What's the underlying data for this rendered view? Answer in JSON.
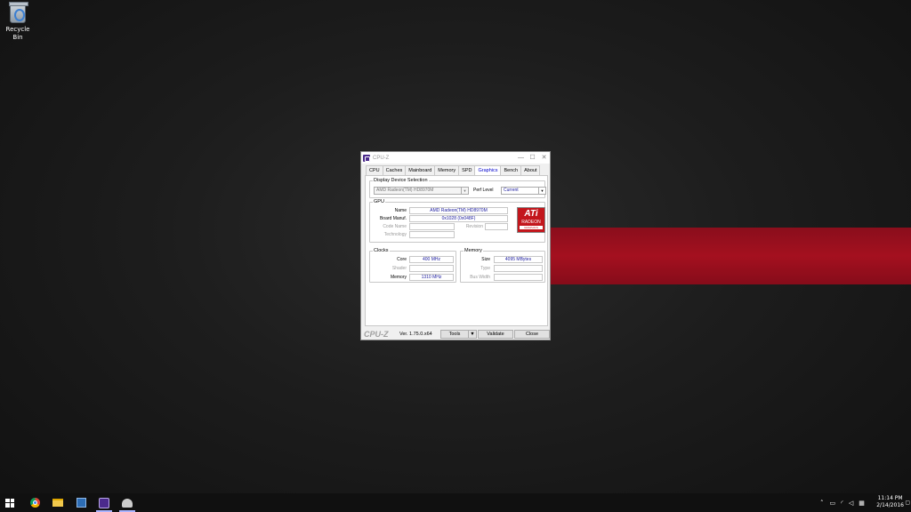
{
  "desktop": {
    "icons": [
      {
        "label": "Recycle Bin",
        "icon": "recycle-bin-icon"
      }
    ]
  },
  "window": {
    "title": "CPU-Z",
    "controls": {
      "minimize": "—",
      "maximize": "☐",
      "close": "✕"
    },
    "tabs": [
      "CPU",
      "Caches",
      "Mainboard",
      "Memory",
      "SPD",
      "Graphics",
      "Bench",
      "About"
    ],
    "active_tab": "Graphics",
    "display_device": {
      "legend": "Display Device Selection",
      "device": "AMD Radeon(TM) HD8970M",
      "perf_level_label": "Perf Level",
      "perf_level": "Current"
    },
    "gpu": {
      "legend": "GPU",
      "name_label": "Name",
      "name": "AMD Radeon(TM) HD8970M",
      "board_label": "Board Manuf.",
      "board": "0x1028 (0x048F)",
      "code_label": "Code Name",
      "revision_label": "Revision",
      "technology_label": "Technology",
      "logo": {
        "line1": "ATi",
        "line2": "RADEON",
        "line3": "GRAPHICS"
      }
    },
    "clocks": {
      "legend": "Clocks",
      "core_label": "Core",
      "core": "400 MHz",
      "shader_label": "Shader",
      "memory_label": "Memory",
      "memory": "1310 MHz"
    },
    "memory": {
      "legend": "Memory",
      "size_label": "Size",
      "size": "4095 MBytes",
      "type_label": "Type",
      "bus_label": "Bus Width"
    },
    "footer": {
      "brand": "CPU-Z",
      "version": "Ver. 1.75.0.x64",
      "tools": "Tools",
      "validate": "Validate",
      "close": "Close"
    }
  },
  "taskbar": {
    "items": [
      "start-icon",
      "chrome-icon",
      "file-explorer-icon",
      "task-manager-icon",
      "cpu-z-icon",
      "app-icon"
    ],
    "tray_icons": [
      "chevron-up-icon",
      "battery-icon",
      "wifi-icon",
      "volume-icon",
      "keyboard-icon",
      "notifications-icon"
    ],
    "time": "11:14 PM",
    "date": "2/14/2016"
  }
}
